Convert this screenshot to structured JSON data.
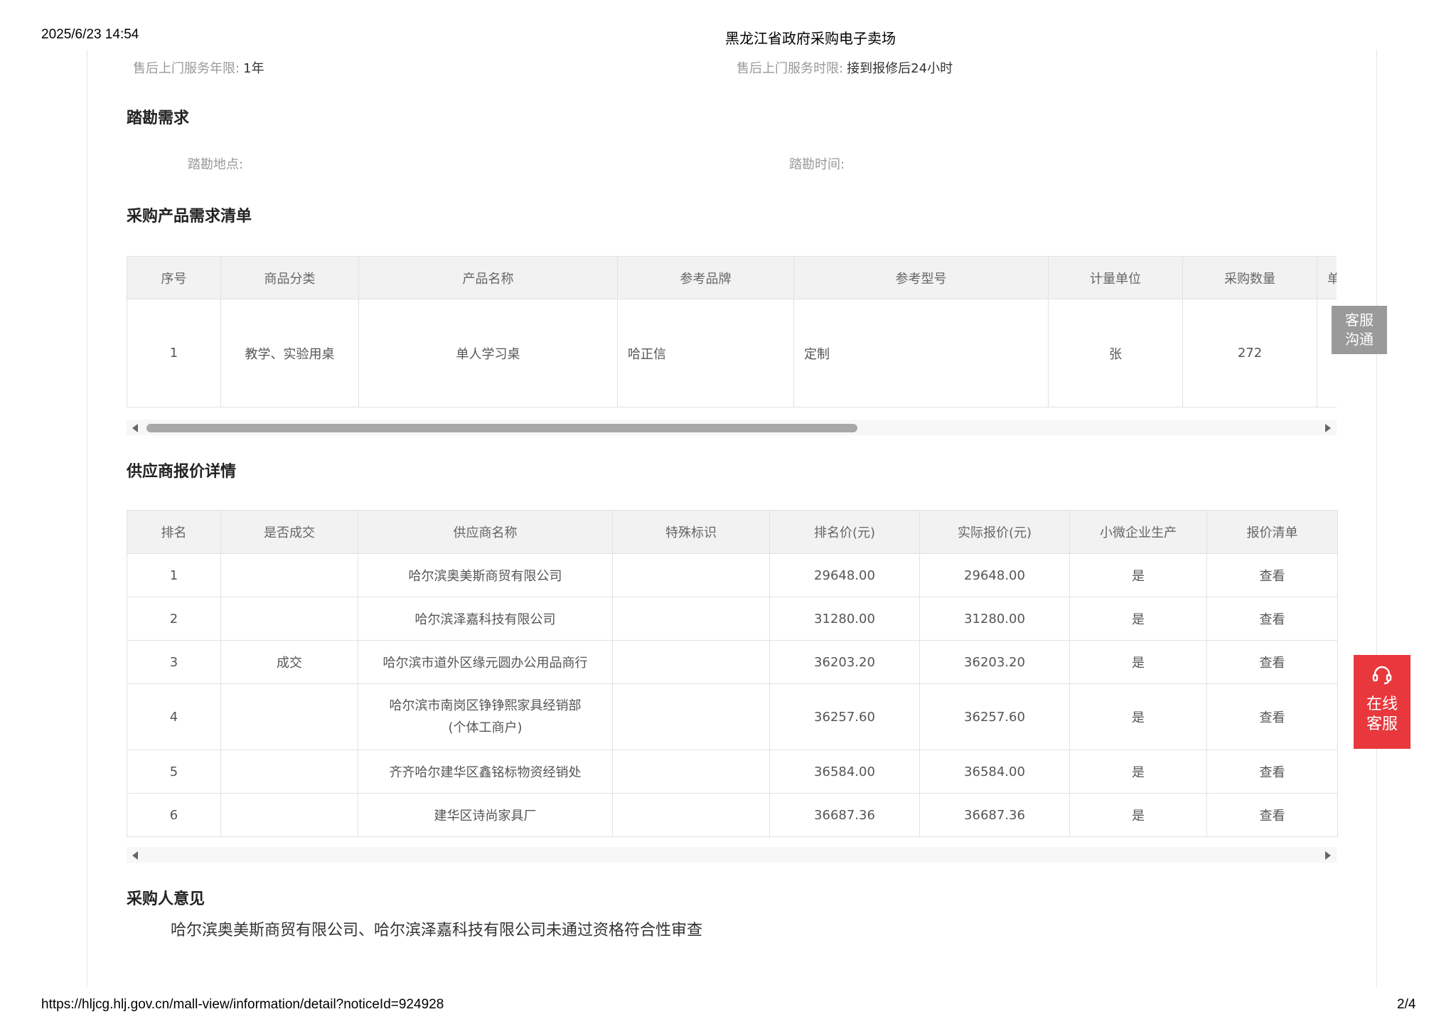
{
  "print_header": {
    "datetime": "2025/6/23 14:54",
    "site_title": "黑龙江省政府采购电子卖场"
  },
  "print_footer": {
    "url": "https://hljcg.hlj.gov.cn/mall-view/information/detail?noticeId=924928",
    "page": "2/4"
  },
  "after_sales": {
    "years_label": "售后上门服务年限:",
    "years_value": "1年",
    "time_label": "售后上门服务时限:",
    "time_value": "接到报修后24小时"
  },
  "survey": {
    "title": "踏勘需求",
    "location_label": "踏勘地点:",
    "time_label": "踏勘时间:"
  },
  "products": {
    "title": "采购产品需求清单",
    "headers": [
      "序号",
      "商品分类",
      "产品名称",
      "参考品牌",
      "参考型号",
      "计量单位",
      "采购数量",
      "单"
    ],
    "rows": [
      [
        "1",
        "教学、实验用桌",
        "单人学习桌",
        "哈正信",
        "定制",
        "张",
        "272",
        ""
      ]
    ]
  },
  "quotes": {
    "title": "供应商报价详情",
    "headers": [
      "排名",
      "是否成交",
      "供应商名称",
      "特殊标识",
      "排名价(元)",
      "实际报价(元)",
      "小微企业生产",
      "报价清单"
    ],
    "rows": [
      [
        "1",
        "",
        "哈尔滨奥美斯商贸有限公司",
        "",
        "29648.00",
        "29648.00",
        "是",
        "查看"
      ],
      [
        "2",
        "",
        "哈尔滨泽嘉科技有限公司",
        "",
        "31280.00",
        "31280.00",
        "是",
        "查看"
      ],
      [
        "3",
        "成交",
        "哈尔滨市道外区缘元圆办公用品商行",
        "",
        "36203.20",
        "36203.20",
        "是",
        "查看"
      ],
      [
        "4",
        "",
        "哈尔滨市南岗区铮铮熙家具经销部",
        "",
        "36257.60",
        "36257.60",
        "是",
        "查看"
      ],
      [
        "5",
        "",
        "齐齐哈尔建华区鑫铭标物资经销处",
        "",
        "36584.00",
        "36584.00",
        "是",
        "查看"
      ],
      [
        "6",
        "",
        "建华区诗尚家具厂",
        "",
        "36687.36",
        "36687.36",
        "是",
        "查看"
      ]
    ],
    "row4_name_line2": "(个体工商户)"
  },
  "buyer_opinion": {
    "title": "采购人意见",
    "text": "哈尔滨奥美斯商贸有限公司、哈尔滨泽嘉科技有限公司未通过资格符合性审查"
  },
  "widgets": {
    "kefu_gray": [
      "客服",
      "沟通"
    ],
    "kefu_red": [
      "在线",
      "客服"
    ],
    "headset_icon": "headset-icon"
  },
  "colors": {
    "link": "#1a6fd4",
    "kefu_red": "#e8383d",
    "kefu_gray": "#9a9a9a"
  }
}
